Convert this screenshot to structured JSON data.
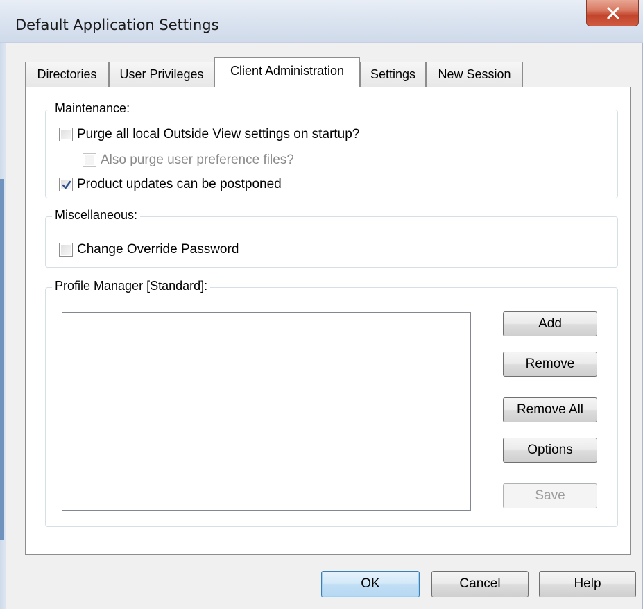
{
  "window": {
    "title": "Default Application Settings",
    "close_label": "X"
  },
  "tabs": [
    {
      "label": "Directories",
      "active": false
    },
    {
      "label": "User Privileges",
      "active": false
    },
    {
      "label": "Client Administration",
      "active": true
    },
    {
      "label": "Settings",
      "active": false
    },
    {
      "label": "New Session",
      "active": false
    }
  ],
  "maintenance": {
    "legend": "Maintenance:",
    "purge_settings": {
      "label": "Purge all local Outside View settings on startup?",
      "checked": false
    },
    "purge_prefs": {
      "label": "Also purge user preference files?",
      "checked": false,
      "disabled": true
    },
    "updates_postponed": {
      "label": "Product updates can be postponed",
      "checked": true
    }
  },
  "miscellaneous": {
    "legend": "Miscellaneous:",
    "change_password": {
      "label": "Change Override Password",
      "checked": false
    }
  },
  "profile_manager": {
    "legend": "Profile Manager [Standard]:",
    "items": [],
    "buttons": {
      "add": "Add",
      "remove": "Remove",
      "remove_all": "Remove All",
      "options": "Options",
      "save": "Save"
    }
  },
  "footer": {
    "ok": "OK",
    "cancel": "Cancel",
    "help": "Help"
  },
  "colors": {
    "titlebar": "#dbe4f0",
    "close_button": "#c2442b",
    "dialog_bg": "#f0f0f0",
    "panel_bg": "#ffffff",
    "default_button": "#c1def5"
  }
}
